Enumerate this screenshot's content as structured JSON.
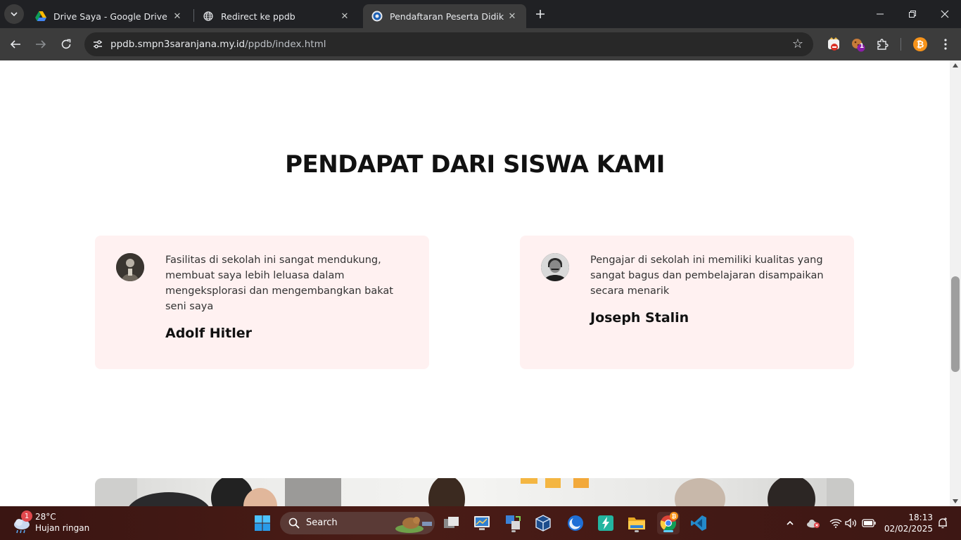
{
  "browser": {
    "tabs": [
      {
        "title": "Drive Saya - Google Drive",
        "active": false
      },
      {
        "title": "Redirect ke ppdb",
        "active": false
      },
      {
        "title": "Pendaftaran Peserta Didik Baru",
        "active": true
      }
    ],
    "url": {
      "host": "ppdb.smpn3saranjana.my.id",
      "path": "/ppdb/index.html"
    },
    "extension_badge": "1"
  },
  "page": {
    "section_title": "PENDAPAT DARI SISWA KAMI",
    "testimonials": [
      {
        "quote": "Fasilitas di sekolah ini sangat mendukung, membuat saya lebih leluasa dalam mengeksplorasi dan mengembangkan bakat seni saya",
        "name": "Adolf Hitler"
      },
      {
        "quote": "Pengajar di sekolah ini memiliki kualitas yang sangat bagus dan pembelajaran disampaikan secara menarik",
        "name": "Joseph Stalin"
      }
    ]
  },
  "taskbar": {
    "weather": {
      "temp": "28°C",
      "condition": "Hujan ringan",
      "badge": "1"
    },
    "search_label": "Search",
    "clock": {
      "time": "18:13",
      "date": "02/02/2025"
    }
  },
  "colors": {
    "card_bg": "#fff1f1",
    "accent": "#60cdff"
  }
}
